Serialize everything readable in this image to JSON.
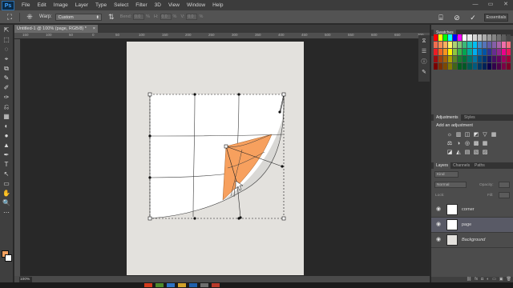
{
  "app": {
    "logo": "Ps"
  },
  "menu": [
    "File",
    "Edit",
    "Image",
    "Layer",
    "Type",
    "Select",
    "Filter",
    "3D",
    "View",
    "Window",
    "Help"
  ],
  "window_controls": [
    "—",
    "▭",
    "✕"
  ],
  "options_bar": {
    "warp_label": "Warp:",
    "warp_value": "Custom",
    "bend_label": "Bend:",
    "bend_value": "0.0",
    "bend_unit": "%",
    "h_label": "H:",
    "h_value": "0.0",
    "h_unit": "%",
    "v_label": "V:",
    "v_value": "0.0",
    "v_unit": "%",
    "workspace": "Essentials"
  },
  "document": {
    "tab_title": "Untitled-1 @ 100% (page, RGB/8) *",
    "ruler_ticks": [
      "150",
      "100",
      "50",
      "0",
      "50",
      "100",
      "150",
      "200",
      "250",
      "300",
      "350",
      "400",
      "450",
      "500",
      "550",
      "600",
      "650",
      "700"
    ],
    "zoom": "100%"
  },
  "panels": {
    "swatches_tab": "Swatches",
    "adjustments_tab": "Adjustments",
    "styles_tab": "Styles",
    "adjustments_title": "Add an adjustment",
    "layers_tab": "Layers",
    "channels_tab": "Channels",
    "paths_tab": "Paths",
    "kind_label": "Kind",
    "blend_mode": "Normal",
    "opacity_label": "Opacity:",
    "lock_label": "Lock:",
    "fill_label": "Fill:",
    "layers": [
      {
        "name": "corner",
        "thumb": "#ffffff"
      },
      {
        "name": "page",
        "thumb": "#ffffff",
        "selected": true
      },
      {
        "name": "Background",
        "thumb": "#e3e1dd",
        "italic": true
      }
    ]
  },
  "colors": {
    "foreground": "#f2a15f",
    "background": "#ffffff",
    "curl_fill": "#f7a05e",
    "accent": "#3fa2ff"
  },
  "swatch_colors": [
    "#ff0000",
    "#ffff00",
    "#00ff00",
    "#00ffff",
    "#0000ff",
    "#ff00ff",
    "#ffffff",
    "#ebebeb",
    "#d6d6d6",
    "#c2c2c2",
    "#adadad",
    "#999999",
    "#858585",
    "#707070",
    "#5c5c5c",
    "#474747",
    "#f26c4f",
    "#f68e55",
    "#fbaf5c",
    "#fff467",
    "#acd372",
    "#7cc576",
    "#3bb878",
    "#1abbb4",
    "#00bff3",
    "#438ccb",
    "#5574b9",
    "#605ca8",
    "#855fa8",
    "#a763a9",
    "#f06ea9",
    "#f26d7d",
    "#ed1c24",
    "#f26522",
    "#f7941d",
    "#fff200",
    "#8dc63f",
    "#39b54a",
    "#00a651",
    "#00a99d",
    "#00aeef",
    "#0072bc",
    "#0054a6",
    "#2e3192",
    "#662d91",
    "#92278f",
    "#ec008c",
    "#ed145b",
    "#9e0b0f",
    "#a0410d",
    "#a36209",
    "#aba000",
    "#598527",
    "#1a7b30",
    "#007236",
    "#00746b",
    "#0076a3",
    "#004b80",
    "#003471",
    "#1b1464",
    "#440e62",
    "#630460",
    "#9e005d",
    "#9e0039",
    "#790000",
    "#7b2e00",
    "#7d4900",
    "#827b00",
    "#406618",
    "#005e20",
    "#005826",
    "#005952",
    "#005b7f",
    "#003663",
    "#002157",
    "#0d004c",
    "#32004b",
    "#4b0049",
    "#7b0046",
    "#7a0026"
  ],
  "tools": [
    "⇱",
    "⬚",
    "◌",
    "⌖",
    "⧉",
    "✎",
    "✐",
    "✑",
    "⎌",
    "▦",
    "◐",
    "●",
    "▲",
    "✒",
    "T",
    "↖",
    "▭",
    "✋",
    "🔍",
    "⋯"
  ],
  "adjustment_icons": [
    "☼",
    "▥",
    "◫",
    "◩",
    "▽",
    "▦",
    "",
    "⚖",
    "◑",
    "◎",
    "▩",
    "▦",
    "",
    "",
    "◪",
    "◭",
    "▤",
    "▧",
    "▨",
    "",
    ""
  ],
  "taskbar_colors": [
    "#d23a1c",
    "#4c8a2b",
    "#2c72c5",
    "#d0a12a",
    "#1f5fab",
    "#6e6e6e",
    "#b8392a"
  ]
}
